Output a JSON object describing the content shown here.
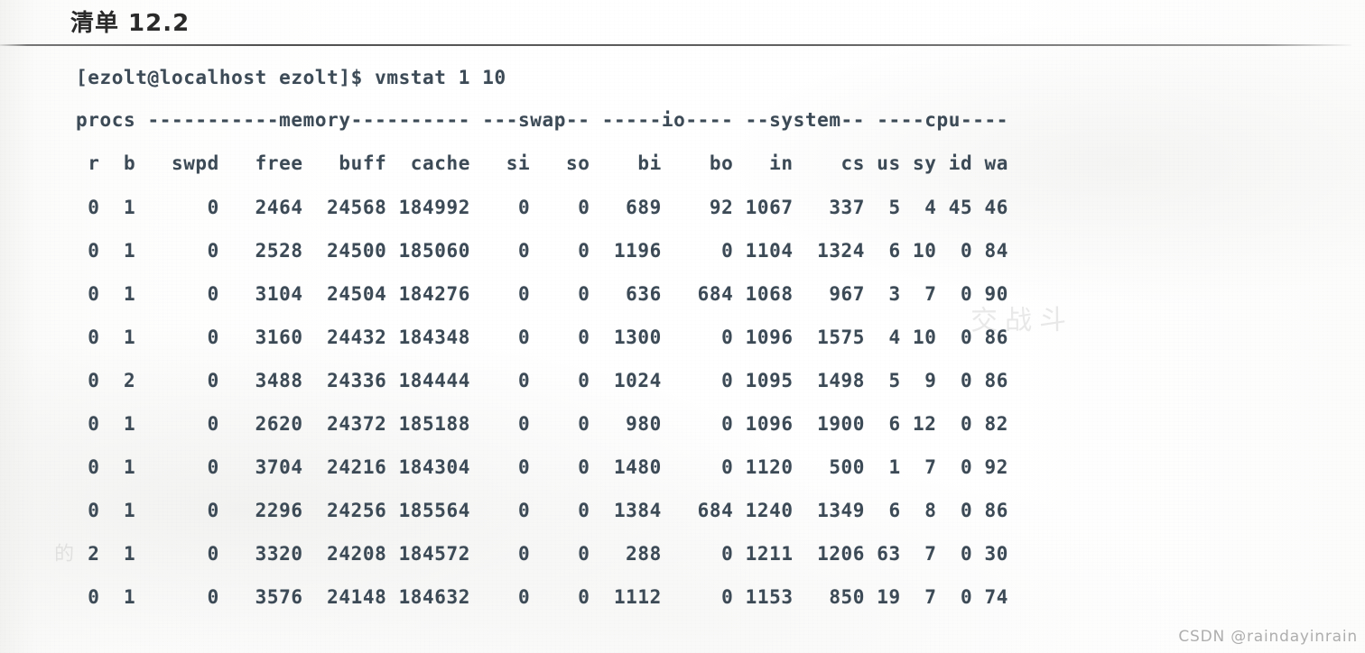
{
  "page": {
    "title": "清单 12.2",
    "watermark": "CSDN @raindayinrain",
    "bleed_text_right": "交战斗",
    "bleed_text_left": "的"
  },
  "terminal": {
    "prompt_line": "[ezolt@localhost ezolt]$ vmstat 1 10",
    "command": "vmstat 1 10",
    "prompt": "[ezolt@localhost ezolt]$",
    "user": "ezolt",
    "host": "localhost",
    "cwd": "ezolt",
    "group_header": "procs -----------memory---------- ---swap-- -----io---- --system-- ----cpu----",
    "groups": [
      "procs",
      "memory",
      "swap",
      "io",
      "system",
      "cpu"
    ],
    "column_header": " r  b   swpd   free   buff  cache   si   so    bi    bo   in    cs us sy id wa",
    "columns": [
      "r",
      "b",
      "swpd",
      "free",
      "buff",
      "cache",
      "si",
      "so",
      "bi",
      "bo",
      "in",
      "cs",
      "us",
      "sy",
      "id",
      "wa"
    ],
    "rows": [
      " 0  1      0   2464  24568 184992    0    0   689    92 1067   337  5  4 45 46",
      " 0  1      0   2528  24500 185060    0    0  1196     0 1104  1324  6 10  0 84",
      " 0  1      0   3104  24504 184276    0    0   636   684 1068   967  3  7  0 90",
      " 0  1      0   3160  24432 184348    0    0  1300     0 1096  1575  4 10  0 86",
      " 0  2      0   3488  24336 184444    0    0  1024     0 1095  1498  5  9  0 86",
      " 0  1      0   2620  24372 185188    0    0   980     0 1096  1900  6 12  0 82",
      " 0  1      0   3704  24216 184304    0    0  1480     0 1120   500  1  7  0 92",
      " 0  1      0   2296  24256 185564    0    0  1384   684 1240  1349  6  8  0 86",
      " 2  1      0   3320  24208 184572    0    0   288     0 1211  1206 63  7  0 30",
      " 0  1      0   3576  24148 184632    0    0  1112     0 1153   850 19  7  0 74"
    ],
    "rows_values": [
      {
        "r": 0,
        "b": 1,
        "swpd": 0,
        "free": 2464,
        "buff": 24568,
        "cache": 184992,
        "si": 0,
        "so": 0,
        "bi": 689,
        "bo": 92,
        "in": 1067,
        "cs": 337,
        "us": 5,
        "sy": 4,
        "id": 45,
        "wa": 46
      },
      {
        "r": 0,
        "b": 1,
        "swpd": 0,
        "free": 2528,
        "buff": 24500,
        "cache": 185060,
        "si": 0,
        "so": 0,
        "bi": 1196,
        "bo": 0,
        "in": 1104,
        "cs": 1324,
        "us": 6,
        "sy": 10,
        "id": 0,
        "wa": 84
      },
      {
        "r": 0,
        "b": 1,
        "swpd": 0,
        "free": 3104,
        "buff": 24504,
        "cache": 184276,
        "si": 0,
        "so": 0,
        "bi": 636,
        "bo": 684,
        "in": 1068,
        "cs": 967,
        "us": 3,
        "sy": 7,
        "id": 0,
        "wa": 90
      },
      {
        "r": 0,
        "b": 1,
        "swpd": 0,
        "free": 3160,
        "buff": 24432,
        "cache": 184348,
        "si": 0,
        "so": 0,
        "bi": 1300,
        "bo": 0,
        "in": 1096,
        "cs": 1575,
        "us": 4,
        "sy": 10,
        "id": 0,
        "wa": 86
      },
      {
        "r": 0,
        "b": 2,
        "swpd": 0,
        "free": 3488,
        "buff": 24336,
        "cache": 184444,
        "si": 0,
        "so": 0,
        "bi": 1024,
        "bo": 0,
        "in": 1095,
        "cs": 1498,
        "us": 5,
        "sy": 9,
        "id": 0,
        "wa": 86
      },
      {
        "r": 0,
        "b": 1,
        "swpd": 0,
        "free": 2620,
        "buff": 24372,
        "cache": 185188,
        "si": 0,
        "so": 0,
        "bi": 980,
        "bo": 0,
        "in": 1096,
        "cs": 1900,
        "us": 6,
        "sy": 12,
        "id": 0,
        "wa": 82
      },
      {
        "r": 0,
        "b": 1,
        "swpd": 0,
        "free": 3704,
        "buff": 24216,
        "cache": 184304,
        "si": 0,
        "so": 0,
        "bi": 1480,
        "bo": 0,
        "in": 1120,
        "cs": 500,
        "us": 1,
        "sy": 7,
        "id": 0,
        "wa": 92
      },
      {
        "r": 0,
        "b": 1,
        "swpd": 0,
        "free": 2296,
        "buff": 24256,
        "cache": 185564,
        "si": 0,
        "so": 0,
        "bi": 1384,
        "bo": 684,
        "in": 1240,
        "cs": 1349,
        "us": 6,
        "sy": 8,
        "id": 0,
        "wa": 86
      },
      {
        "r": 2,
        "b": 1,
        "swpd": 0,
        "free": 3320,
        "buff": 24208,
        "cache": 184572,
        "si": 0,
        "so": 0,
        "bi": 288,
        "bo": 0,
        "in": 1211,
        "cs": 1206,
        "us": 63,
        "sy": 7,
        "id": 0,
        "wa": 30
      },
      {
        "r": 0,
        "b": 1,
        "swpd": 0,
        "free": 3576,
        "buff": 24148,
        "cache": 184632,
        "si": 0,
        "so": 0,
        "bi": 1112,
        "bo": 0,
        "in": 1153,
        "cs": 850,
        "us": 19,
        "sy": 7,
        "id": 0,
        "wa": 74
      }
    ]
  },
  "colors": {
    "paper": "#ffffff",
    "text": "#3c4a56",
    "title": "#2a2a2a",
    "rule": "#4b4b4b",
    "watermark": "#aaaaaa"
  }
}
